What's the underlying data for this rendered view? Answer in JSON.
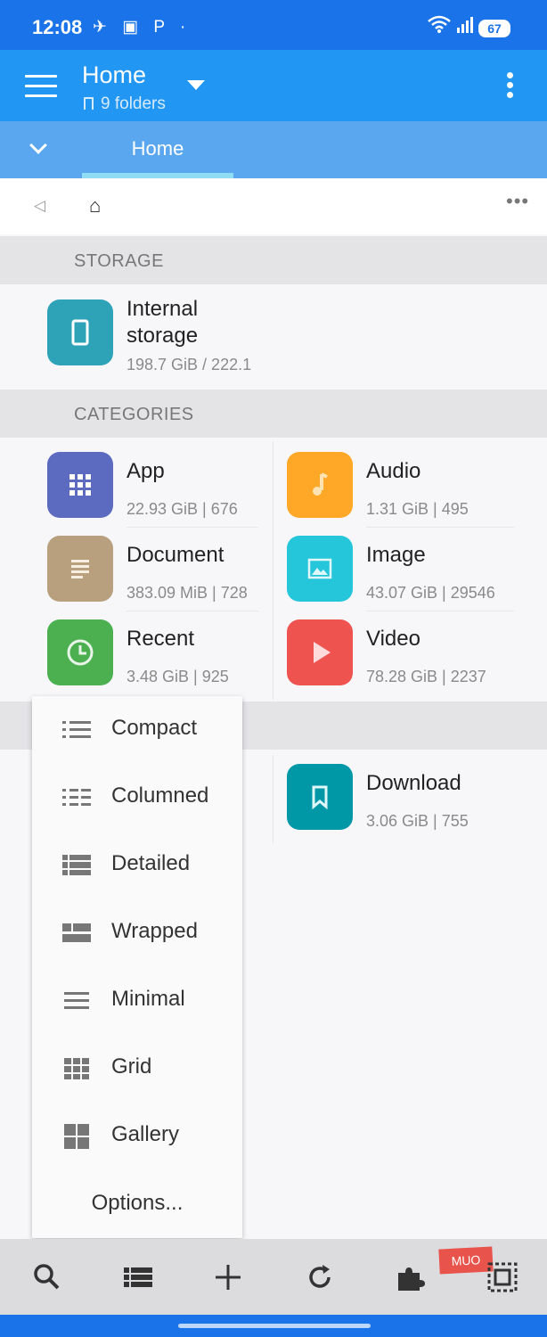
{
  "status": {
    "time": "12:08",
    "notif_icons": "✈ ▣ P ·",
    "battery": "67"
  },
  "appbar": {
    "title": "Home",
    "subtitle": "9 folders"
  },
  "tabs": {
    "active": "Home"
  },
  "sections": {
    "storage": "STORAGE",
    "categories": "CATEGORIES"
  },
  "storage": {
    "name_line1": "Internal",
    "name_line2": "storage",
    "usage": "198.7 GiB / 222.1"
  },
  "categories": [
    {
      "name": "App",
      "info": "22.93 GiB | 676",
      "color": "#5c6bc0",
      "icon": "grid-icon"
    },
    {
      "name": "Audio",
      "info": "1.31 GiB | 495",
      "color": "#ffa726",
      "icon": "music-note-icon"
    },
    {
      "name": "Document",
      "info": "383.09 MiB | 728",
      "color": "#b8a07e",
      "icon": "document-icon"
    },
    {
      "name": "Image",
      "info": "43.07 GiB | 29546",
      "color": "#26c6da",
      "icon": "image-icon"
    },
    {
      "name": "Recent",
      "info": "3.48 GiB | 925",
      "color": "#4caf50",
      "icon": "clock-icon"
    },
    {
      "name": "Video",
      "info": "78.28 GiB | 2237",
      "color": "#ef5350",
      "icon": "play-icon"
    }
  ],
  "bookmarks": [
    {
      "name": "Download",
      "info": "3.06 GiB | 755",
      "color": "#0097a7",
      "icon": "bookmark-icon"
    }
  ],
  "view_menu": {
    "items": [
      "Compact",
      "Columned",
      "Detailed",
      "Wrapped",
      "Minimal",
      "Grid",
      "Gallery"
    ],
    "options": "Options..."
  },
  "bottom_badge": "MUO"
}
